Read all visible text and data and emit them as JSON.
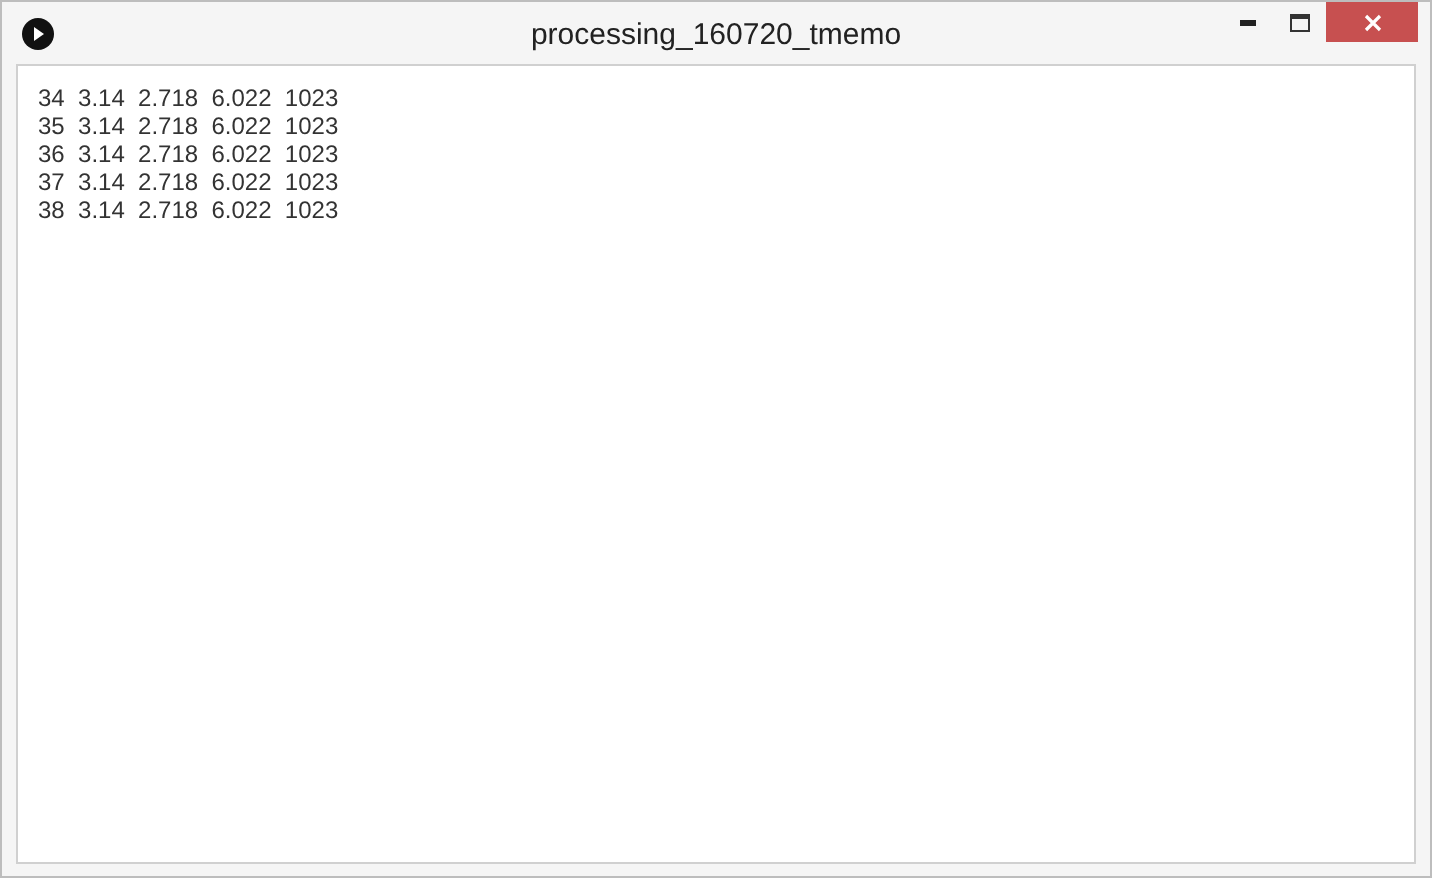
{
  "window": {
    "title": "processing_160720_tmemo"
  },
  "lines": [
    "34  3.14  2.718  6.022  1023",
    "35  3.14  2.718  6.022  1023",
    "36  3.14  2.718  6.022  1023",
    "37  3.14  2.718  6.022  1023",
    "38  3.14  2.718  6.022  1023"
  ]
}
